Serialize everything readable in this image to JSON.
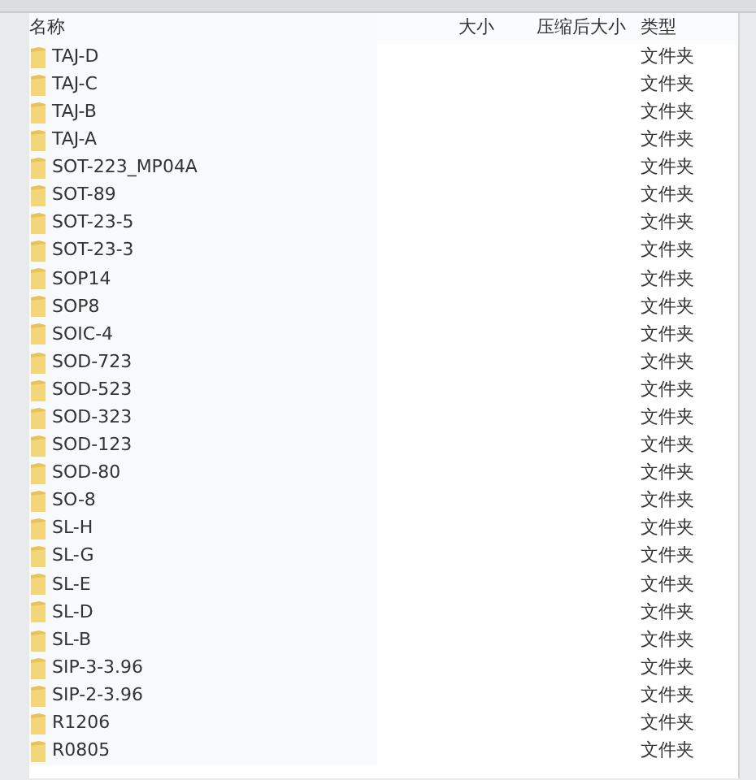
{
  "table": {
    "columns": [
      {
        "label": "名称",
        "kind": "name"
      },
      {
        "label": "大小",
        "kind": "size"
      },
      {
        "label": "压缩后大小",
        "kind": "packed"
      },
      {
        "label": "类型",
        "kind": "type"
      }
    ],
    "rows": [
      {
        "name": "TAJ-D",
        "type": "文件夹"
      },
      {
        "name": "TAJ-C",
        "type": "文件夹"
      },
      {
        "name": "TAJ-B",
        "type": "文件夹"
      },
      {
        "name": "TAJ-A",
        "type": "文件夹"
      },
      {
        "name": "SOT-223_MP04A",
        "type": "文件夹"
      },
      {
        "name": "SOT-89",
        "type": "文件夹"
      },
      {
        "name": "SOT-23-5",
        "type": "文件夹"
      },
      {
        "name": "SOT-23-3",
        "type": "文件夹"
      },
      {
        "name": "SOP14",
        "type": "文件夹"
      },
      {
        "name": "SOP8",
        "type": "文件夹"
      },
      {
        "name": "SOIC-4",
        "type": "文件夹"
      },
      {
        "name": "SOD-723",
        "type": "文件夹"
      },
      {
        "name": "SOD-523",
        "type": "文件夹"
      },
      {
        "name": "SOD-323",
        "type": "文件夹"
      },
      {
        "name": "SOD-123",
        "type": "文件夹"
      },
      {
        "name": "SOD-80",
        "type": "文件夹"
      },
      {
        "name": "SO-8",
        "type": "文件夹"
      },
      {
        "name": "SL-H",
        "type": "文件夹"
      },
      {
        "name": "SL-G",
        "type": "文件夹"
      },
      {
        "name": "SL-E",
        "type": "文件夹"
      },
      {
        "name": "SL-D",
        "type": "文件夹"
      },
      {
        "name": "SL-B",
        "type": "文件夹"
      },
      {
        "name": "SIP-3-3.96",
        "type": "文件夹"
      },
      {
        "name": "SIP-2-3.96",
        "type": "文件夹"
      },
      {
        "name": "R1206",
        "type": "文件夹"
      },
      {
        "name": "R0805",
        "type": "文件夹"
      }
    ]
  }
}
